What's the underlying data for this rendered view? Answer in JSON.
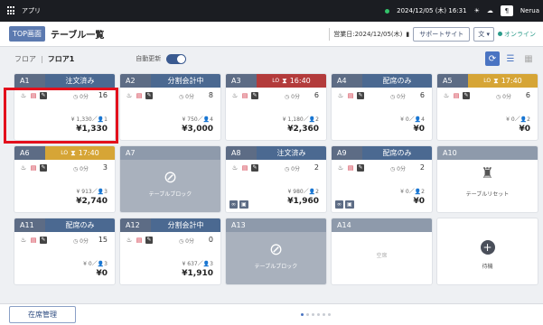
{
  "app": {
    "name": "アプリ",
    "datetime": "2024/12/05 (木) 16:31",
    "extra": "Nerua"
  },
  "header": {
    "top_button": "TOP画面",
    "title": "テーブル一覧",
    "business_date": "営業日:2024/12/05(木)",
    "support": "サポートサイト",
    "lang": "文",
    "online": "オンライン"
  },
  "floor": {
    "label": "フロア",
    "name": "フロア1",
    "auto_update": "自動更新",
    "auto_update_on": true
  },
  "tables": [
    {
      "id": "A1",
      "status": "注文済み",
      "status_color": "#4b6991",
      "guests": "16",
      "elapsed": "0分",
      "subtotal": "¥ 1,330／👤1",
      "total": "¥1,330"
    },
    {
      "id": "A2",
      "status": "分割会計中",
      "status_color": "#4b6991",
      "guests": "8",
      "elapsed": "0分",
      "subtotal": "¥ 750／👤4",
      "total": "¥3,000"
    },
    {
      "id": "A3",
      "status": "16:40",
      "lo": "LO",
      "status_color": "#b33b3b",
      "guests": "6",
      "elapsed": "0分",
      "subtotal": "¥ 1,180／👤2",
      "total": "¥2,360"
    },
    {
      "id": "A4",
      "status": "配席のみ",
      "status_color": "#4b6991",
      "guests": "6",
      "elapsed": "0分",
      "subtotal": "¥ 0／👤4",
      "total": "¥0"
    },
    {
      "id": "A5",
      "status": "17:40",
      "lo": "LO",
      "status_color": "#d6a536",
      "guests": "6",
      "elapsed": "0分",
      "subtotal": "¥ 0／👤2",
      "total": "¥0"
    },
    {
      "id": "A6",
      "status": "17:40",
      "lo": "LO",
      "status_color": "#d6a536",
      "guests": "3",
      "elapsed": "0分",
      "subtotal": "¥ 913／👤3",
      "total": "¥2,740"
    },
    {
      "id": "A7",
      "blocked": "テーブルブロック"
    },
    {
      "id": "A8",
      "status": "注文済み",
      "status_color": "#4b6991",
      "guests": "2",
      "elapsed": "0分",
      "subtotal": "¥ 980／👤2",
      "total": "¥1,960"
    },
    {
      "id": "A9",
      "status": "配席のみ",
      "status_color": "#4b6991",
      "guests": "2",
      "elapsed": "0分",
      "subtotal": "¥ 0／👤2",
      "total": "¥0"
    },
    {
      "id": "A10",
      "reset": "テーブルリセット"
    },
    {
      "id": "A11",
      "status": "配席のみ",
      "status_color": "#4b6991",
      "guests": "15",
      "elapsed": "0分",
      "subtotal": "¥ 0／👤3",
      "total": "¥0"
    },
    {
      "id": "A12",
      "status": "分割会計中",
      "status_color": "#4b6991",
      "guests": "0",
      "elapsed": "0分",
      "subtotal": "¥ 637／👤3",
      "total": "¥1,910"
    },
    {
      "id": "A13",
      "blocked": "テーブルブロック"
    },
    {
      "id": "A14",
      "vacant": "空席"
    },
    {
      "id": "",
      "waiting": "待機"
    }
  ],
  "footer": {
    "seat_button": "在席管理"
  }
}
